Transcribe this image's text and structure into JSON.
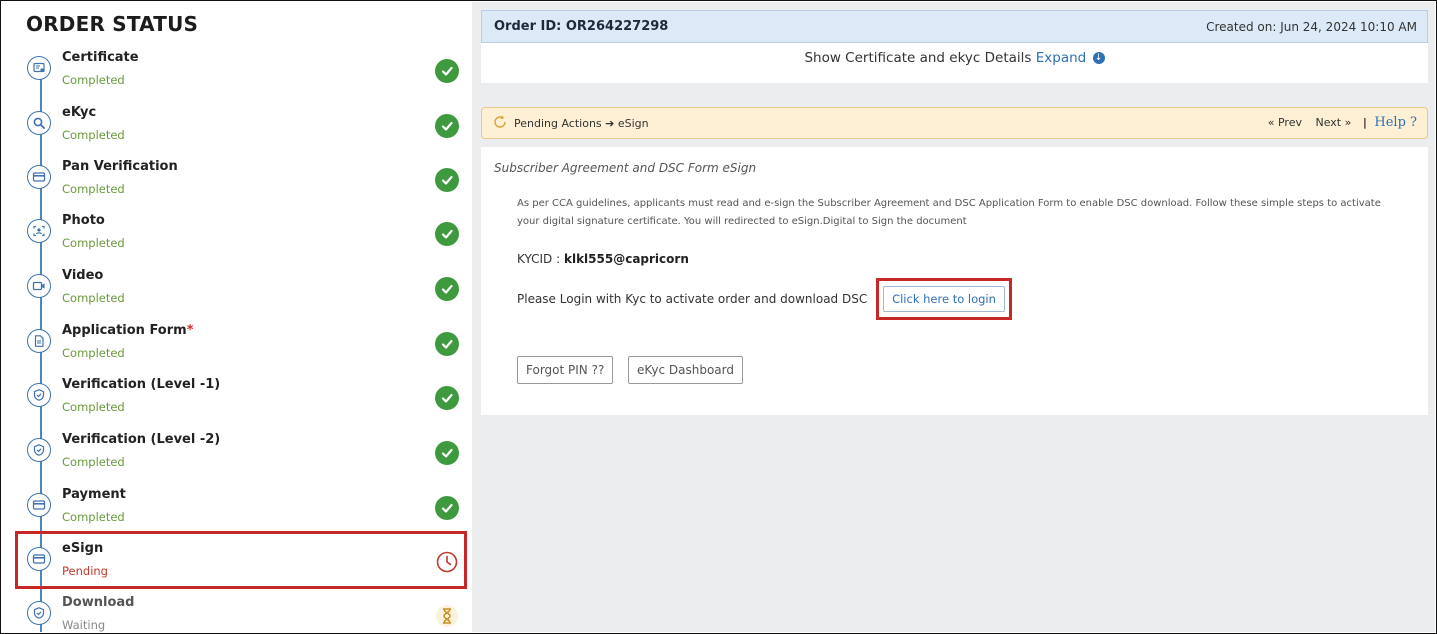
{
  "sidebar": {
    "title": "ORDER STATUS",
    "steps": [
      {
        "name": "Certificate",
        "status": "Completed",
        "icon": "certificate-icon",
        "state": "done"
      },
      {
        "name": "eKyc",
        "status": "Completed",
        "icon": "magnifier-icon",
        "state": "done"
      },
      {
        "name": "Pan Verification",
        "status": "Completed",
        "icon": "card-icon",
        "state": "done"
      },
      {
        "name": "Photo",
        "status": "Completed",
        "icon": "face-scan-icon",
        "state": "done"
      },
      {
        "name": "Video",
        "status": "Completed",
        "icon": "video-icon",
        "state": "done"
      },
      {
        "name": "Application Form",
        "required_mark": "*",
        "status": "Completed",
        "icon": "document-icon",
        "state": "done"
      },
      {
        "name": "Verification (Level -1)",
        "status": "Completed",
        "icon": "shield-icon",
        "state": "done"
      },
      {
        "name": "Verification (Level -2)",
        "status": "Completed",
        "icon": "shield-icon",
        "state": "done"
      },
      {
        "name": "Payment",
        "status": "Completed",
        "icon": "card-icon",
        "state": "done"
      },
      {
        "name": "eSign",
        "status": "Pending",
        "icon": "card-icon",
        "state": "pending"
      },
      {
        "name": "Download",
        "status": "Waiting",
        "icon": "shield-icon",
        "state": "waiting"
      }
    ]
  },
  "order": {
    "id_label": "Order ID: OR264227298",
    "created_label": "Created on: Jun 24, 2024 10:10 AM",
    "show_details_text": "Show Certificate and ekyc Details",
    "expand_label": "Expand"
  },
  "pending_actions": {
    "breadcrumb": "Pending Actions ➔ eSign",
    "prev_label": "« Prev",
    "next_label": "Next »",
    "help_label": "Help ?"
  },
  "esign": {
    "subtitle": "Subscriber Agreement and DSC Form eSign",
    "description": "As per CCA guidelines, applicants must read and e-sign the Subscriber Agreement and DSC Application Form to enable DSC download. Follow these simple steps to activate your digital signature certificate. You will redirected to eSign.Digital to Sign the document",
    "kycid_label": "KYCID :",
    "kycid_value": "klkl555@capricorn",
    "login_prompt": "Please Login with Kyc to activate order and download DSC",
    "login_button": "Click here to login",
    "forgot_pin_button": "Forgot PIN ??",
    "dashboard_button": "eKyc Dashboard"
  },
  "colors": {
    "timeline": "#4a86c4",
    "completed_text": "#6a9a3c",
    "pending_text": "#c0392b",
    "check_green": "#3f9a3f",
    "highlight_red": "#c62828",
    "link_blue": "#2f6fb5"
  }
}
